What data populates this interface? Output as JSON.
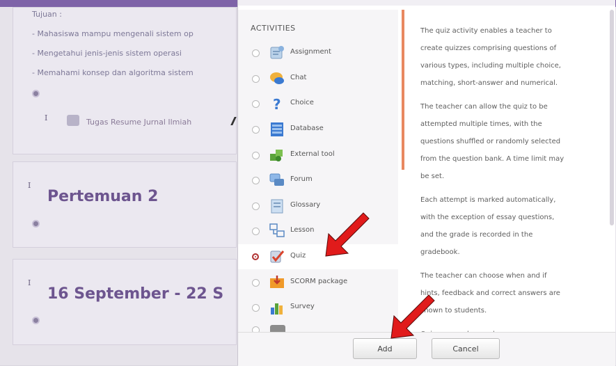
{
  "background": {
    "section_label": "Tujuan :",
    "lines": [
      "- Mahasiswa mampu mengenali sistem op",
      "- Mengetahui jenis-jenis sistem operasi",
      "- Memahami konsep dan algoritma sistem"
    ],
    "resource_link": "Tugas Resume Jurnal Ilmiah",
    "section_2": "Pertemuan 2",
    "section_3": "16 September - 22 S"
  },
  "modal": {
    "section_title": "ACTIVITIES",
    "activities": [
      {
        "label": "Assignment",
        "icon": "assignment-icon"
      },
      {
        "label": "Chat",
        "icon": "chat-icon"
      },
      {
        "label": "Choice",
        "icon": "choice-icon"
      },
      {
        "label": "Database",
        "icon": "database-icon"
      },
      {
        "label": "External tool",
        "icon": "external-tool-icon"
      },
      {
        "label": "Forum",
        "icon": "forum-icon"
      },
      {
        "label": "Glossary",
        "icon": "glossary-icon"
      },
      {
        "label": "Lesson",
        "icon": "lesson-icon"
      },
      {
        "label": "Quiz",
        "icon": "quiz-icon"
      },
      {
        "label": "SCORM package",
        "icon": "scorm-icon"
      },
      {
        "label": "Survey",
        "icon": "survey-icon"
      }
    ],
    "selected": "Quiz",
    "description": [
      "The quiz activity enables a teacher to",
      "create quizzes comprising questions of",
      "various types, including multiple choice,",
      "matching, short-answer and numerical.",
      "",
      "The teacher can allow the quiz to be",
      "attempted multiple times, with the",
      "questions shuffled or randomly selected",
      "from the question bank. A time limit may",
      "be set.",
      "",
      "Each attempt is marked automatically,",
      "with the exception of essay questions,",
      "and the grade is recorded in the",
      "gradebook.",
      "",
      "The teacher can choose when and if",
      "hints, feedback and correct answers are",
      "shown to students.",
      "",
      "Quizzes may be used"
    ],
    "add_label": "Add",
    "cancel_label": "Cancel"
  },
  "colors": {
    "accent": "#e88860",
    "arrow": "#e11b1b",
    "selected_radio": "#b13434"
  }
}
